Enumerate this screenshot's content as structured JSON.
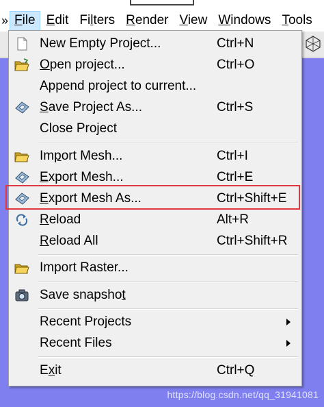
{
  "menubar": {
    "edge_glyph": "»",
    "menus": [
      {
        "name": "File",
        "accel": "F",
        "rest": "ile"
      },
      {
        "name": "Edit",
        "accel": "E",
        "rest": "dit"
      },
      {
        "name": "Filters",
        "pre": "Fi",
        "accel": "l",
        "rest": "ters"
      },
      {
        "name": "Render",
        "accel": "R",
        "rest": "ender"
      },
      {
        "name": "View",
        "accel": "V",
        "rest": "iew"
      },
      {
        "name": "Windows",
        "accel": "W",
        "rest": "indows"
      },
      {
        "name": "Tools",
        "accel": "T",
        "rest": "ools"
      }
    ]
  },
  "file_menu": {
    "new_empty_project": {
      "label": "New Empty Project...",
      "shortcut": "Ctrl+N",
      "icon": "blank-page-icon"
    },
    "open_project": {
      "accel": "O",
      "rest": "pen project...",
      "shortcut": "Ctrl+O",
      "icon": "open-folder-icon"
    },
    "append_project": {
      "label": "Append project to current..."
    },
    "save_project_as": {
      "accel": "S",
      "rest": "ave Project As...",
      "shortcut": "Ctrl+S",
      "icon": "save-disk-icon"
    },
    "close_project": {
      "label": "Close Project"
    },
    "import_mesh": {
      "pre": "Im",
      "accel": "p",
      "rest": "ort Mesh...",
      "shortcut": "Ctrl+I",
      "icon": "open-folder-icon"
    },
    "export_mesh": {
      "accel": "E",
      "rest": "xport Mesh...",
      "shortcut": "Ctrl+E",
      "icon": "save-disk-icon"
    },
    "export_mesh_as": {
      "accel": "E",
      "rest": "xport Mesh As...",
      "shortcut": "Ctrl+Shift+E",
      "icon": "save-disk-icon"
    },
    "reload": {
      "accel": "R",
      "rest": "eload",
      "shortcut": "Alt+R",
      "icon": "reload-icon"
    },
    "reload_all": {
      "accel": "R",
      "rest": "eload All",
      "shortcut": "Ctrl+Shift+R"
    },
    "import_raster": {
      "label": "Import Raster...",
      "icon": "open-folder-icon"
    },
    "save_snapshot": {
      "pre": "Save snapsho",
      "accel": "t",
      "icon": "camera-icon"
    },
    "recent_projects": {
      "label": "Recent Projects"
    },
    "recent_files": {
      "label": "Recent Files"
    },
    "exit": {
      "pre": "E",
      "accel": "x",
      "rest": "it",
      "shortcut": "Ctrl+Q"
    }
  },
  "watermark": "https://blog.csdn.net/qq_31941081",
  "colors": {
    "workspace": "#7f7fef",
    "menu_bg": "#f0f0f0",
    "active_menu_bg": "#cce8ff",
    "highlight_border": "#e0383e"
  }
}
